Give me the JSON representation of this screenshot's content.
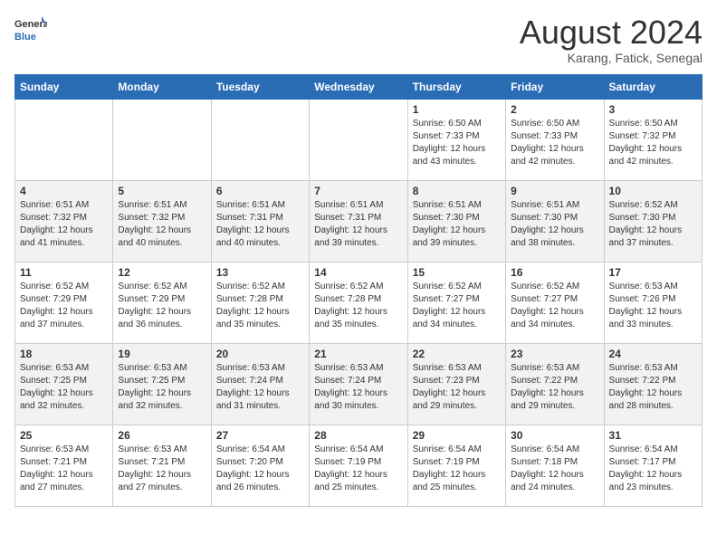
{
  "header": {
    "logo_general": "General",
    "logo_blue": "Blue",
    "month_year": "August 2024",
    "location": "Karang, Fatick, Senegal"
  },
  "weekdays": [
    "Sunday",
    "Monday",
    "Tuesday",
    "Wednesday",
    "Thursday",
    "Friday",
    "Saturday"
  ],
  "weeks": [
    [
      {
        "day": "",
        "sunrise": "",
        "sunset": "",
        "daylight": ""
      },
      {
        "day": "",
        "sunrise": "",
        "sunset": "",
        "daylight": ""
      },
      {
        "day": "",
        "sunrise": "",
        "sunset": "",
        "daylight": ""
      },
      {
        "day": "",
        "sunrise": "",
        "sunset": "",
        "daylight": ""
      },
      {
        "day": "1",
        "sunrise": "Sunrise: 6:50 AM",
        "sunset": "Sunset: 7:33 PM",
        "daylight": "Daylight: 12 hours and 43 minutes."
      },
      {
        "day": "2",
        "sunrise": "Sunrise: 6:50 AM",
        "sunset": "Sunset: 7:33 PM",
        "daylight": "Daylight: 12 hours and 42 minutes."
      },
      {
        "day": "3",
        "sunrise": "Sunrise: 6:50 AM",
        "sunset": "Sunset: 7:32 PM",
        "daylight": "Daylight: 12 hours and 42 minutes."
      }
    ],
    [
      {
        "day": "4",
        "sunrise": "Sunrise: 6:51 AM",
        "sunset": "Sunset: 7:32 PM",
        "daylight": "Daylight: 12 hours and 41 minutes."
      },
      {
        "day": "5",
        "sunrise": "Sunrise: 6:51 AM",
        "sunset": "Sunset: 7:32 PM",
        "daylight": "Daylight: 12 hours and 40 minutes."
      },
      {
        "day": "6",
        "sunrise": "Sunrise: 6:51 AM",
        "sunset": "Sunset: 7:31 PM",
        "daylight": "Daylight: 12 hours and 40 minutes."
      },
      {
        "day": "7",
        "sunrise": "Sunrise: 6:51 AM",
        "sunset": "Sunset: 7:31 PM",
        "daylight": "Daylight: 12 hours and 39 minutes."
      },
      {
        "day": "8",
        "sunrise": "Sunrise: 6:51 AM",
        "sunset": "Sunset: 7:30 PM",
        "daylight": "Daylight: 12 hours and 39 minutes."
      },
      {
        "day": "9",
        "sunrise": "Sunrise: 6:51 AM",
        "sunset": "Sunset: 7:30 PM",
        "daylight": "Daylight: 12 hours and 38 minutes."
      },
      {
        "day": "10",
        "sunrise": "Sunrise: 6:52 AM",
        "sunset": "Sunset: 7:30 PM",
        "daylight": "Daylight: 12 hours and 37 minutes."
      }
    ],
    [
      {
        "day": "11",
        "sunrise": "Sunrise: 6:52 AM",
        "sunset": "Sunset: 7:29 PM",
        "daylight": "Daylight: 12 hours and 37 minutes."
      },
      {
        "day": "12",
        "sunrise": "Sunrise: 6:52 AM",
        "sunset": "Sunset: 7:29 PM",
        "daylight": "Daylight: 12 hours and 36 minutes."
      },
      {
        "day": "13",
        "sunrise": "Sunrise: 6:52 AM",
        "sunset": "Sunset: 7:28 PM",
        "daylight": "Daylight: 12 hours and 35 minutes."
      },
      {
        "day": "14",
        "sunrise": "Sunrise: 6:52 AM",
        "sunset": "Sunset: 7:28 PM",
        "daylight": "Daylight: 12 hours and 35 minutes."
      },
      {
        "day": "15",
        "sunrise": "Sunrise: 6:52 AM",
        "sunset": "Sunset: 7:27 PM",
        "daylight": "Daylight: 12 hours and 34 minutes."
      },
      {
        "day": "16",
        "sunrise": "Sunrise: 6:52 AM",
        "sunset": "Sunset: 7:27 PM",
        "daylight": "Daylight: 12 hours and 34 minutes."
      },
      {
        "day": "17",
        "sunrise": "Sunrise: 6:53 AM",
        "sunset": "Sunset: 7:26 PM",
        "daylight": "Daylight: 12 hours and 33 minutes."
      }
    ],
    [
      {
        "day": "18",
        "sunrise": "Sunrise: 6:53 AM",
        "sunset": "Sunset: 7:25 PM",
        "daylight": "Daylight: 12 hours and 32 minutes."
      },
      {
        "day": "19",
        "sunrise": "Sunrise: 6:53 AM",
        "sunset": "Sunset: 7:25 PM",
        "daylight": "Daylight: 12 hours and 32 minutes."
      },
      {
        "day": "20",
        "sunrise": "Sunrise: 6:53 AM",
        "sunset": "Sunset: 7:24 PM",
        "daylight": "Daylight: 12 hours and 31 minutes."
      },
      {
        "day": "21",
        "sunrise": "Sunrise: 6:53 AM",
        "sunset": "Sunset: 7:24 PM",
        "daylight": "Daylight: 12 hours and 30 minutes."
      },
      {
        "day": "22",
        "sunrise": "Sunrise: 6:53 AM",
        "sunset": "Sunset: 7:23 PM",
        "daylight": "Daylight: 12 hours and 29 minutes."
      },
      {
        "day": "23",
        "sunrise": "Sunrise: 6:53 AM",
        "sunset": "Sunset: 7:22 PM",
        "daylight": "Daylight: 12 hours and 29 minutes."
      },
      {
        "day": "24",
        "sunrise": "Sunrise: 6:53 AM",
        "sunset": "Sunset: 7:22 PM",
        "daylight": "Daylight: 12 hours and 28 minutes."
      }
    ],
    [
      {
        "day": "25",
        "sunrise": "Sunrise: 6:53 AM",
        "sunset": "Sunset: 7:21 PM",
        "daylight": "Daylight: 12 hours and 27 minutes."
      },
      {
        "day": "26",
        "sunrise": "Sunrise: 6:53 AM",
        "sunset": "Sunset: 7:21 PM",
        "daylight": "Daylight: 12 hours and 27 minutes."
      },
      {
        "day": "27",
        "sunrise": "Sunrise: 6:54 AM",
        "sunset": "Sunset: 7:20 PM",
        "daylight": "Daylight: 12 hours and 26 minutes."
      },
      {
        "day": "28",
        "sunrise": "Sunrise: 6:54 AM",
        "sunset": "Sunset: 7:19 PM",
        "daylight": "Daylight: 12 hours and 25 minutes."
      },
      {
        "day": "29",
        "sunrise": "Sunrise: 6:54 AM",
        "sunset": "Sunset: 7:19 PM",
        "daylight": "Daylight: 12 hours and 25 minutes."
      },
      {
        "day": "30",
        "sunrise": "Sunrise: 6:54 AM",
        "sunset": "Sunset: 7:18 PM",
        "daylight": "Daylight: 12 hours and 24 minutes."
      },
      {
        "day": "31",
        "sunrise": "Sunrise: 6:54 AM",
        "sunset": "Sunset: 7:17 PM",
        "daylight": "Daylight: 12 hours and 23 minutes."
      }
    ]
  ]
}
